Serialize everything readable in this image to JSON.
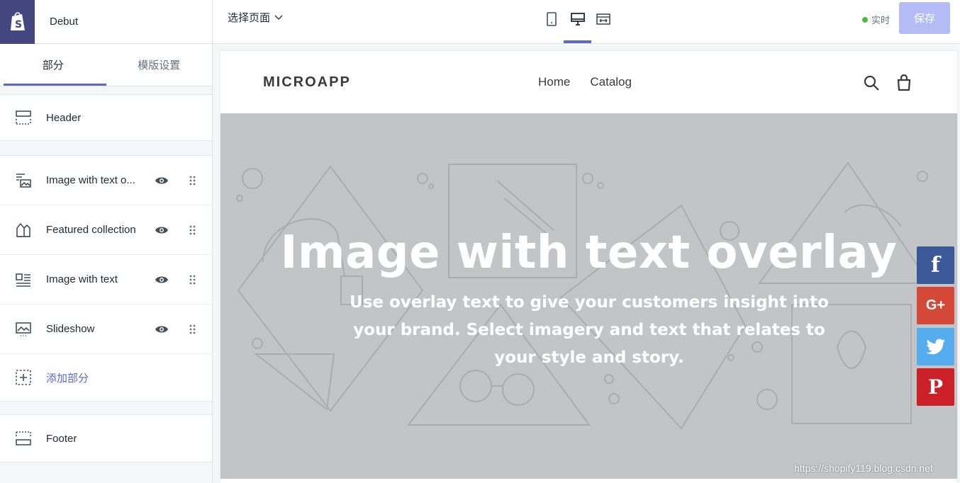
{
  "sidebar": {
    "theme_name": "Debut",
    "tabs": [
      {
        "label": "部分"
      },
      {
        "label": "模版设置"
      }
    ],
    "header_item": {
      "label": "Header"
    },
    "sections": [
      {
        "label": "Image with text o...",
        "icon": "image-overlay-icon"
      },
      {
        "label": "Featured collection",
        "icon": "collection-icon"
      },
      {
        "label": "Image with text",
        "icon": "image-text-icon"
      },
      {
        "label": "Slideshow",
        "icon": "slideshow-icon"
      }
    ],
    "add_section": {
      "label": "添加部分"
    },
    "footer_item": {
      "label": "Footer"
    }
  },
  "topbar": {
    "page_select": "选择页面",
    "live_label": "实时",
    "save_label": "保存",
    "active_device": "desktop"
  },
  "preview": {
    "store_logo": "MICROAPP",
    "nav": [
      {
        "label": "Home"
      },
      {
        "label": "Catalog"
      }
    ],
    "hero": {
      "title": "Image with text overlay",
      "text": "Use overlay text to give your customers insight into your brand. Select imagery and text that relates to your style and story."
    }
  },
  "social": [
    {
      "name": "facebook",
      "glyph": "f"
    },
    {
      "name": "google-plus",
      "glyph": "G+"
    },
    {
      "name": "twitter",
      "glyph": ""
    },
    {
      "name": "pinterest",
      "glyph": "P"
    }
  ],
  "watermark": "https://shopify119.blog.csdn.net",
  "colors": {
    "accent": "#5c6ac4",
    "brand_dark": "#43467f",
    "save_disabled": "#b3bcf5",
    "hero_bg": "#c2c4c6",
    "live": "#50b83c"
  }
}
